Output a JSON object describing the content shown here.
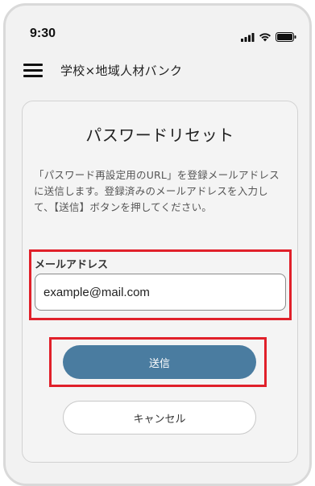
{
  "status_bar": {
    "time": "9:30"
  },
  "header": {
    "title": "学校×地域人材バンク"
  },
  "card": {
    "title": "パスワードリセット",
    "instruction": "「パスワード再設定用のURL」を登録メールアドレスに送信します。登録済みのメールアドレスを入力して、【送信】ボタンを押してください。",
    "email": {
      "label": "メールアドレス",
      "value": "example@mail.com"
    },
    "submit_label": "送信",
    "cancel_label": "キャンセル"
  },
  "colors": {
    "primary_button": "#4a7ca0",
    "highlight": "#e0202a"
  }
}
